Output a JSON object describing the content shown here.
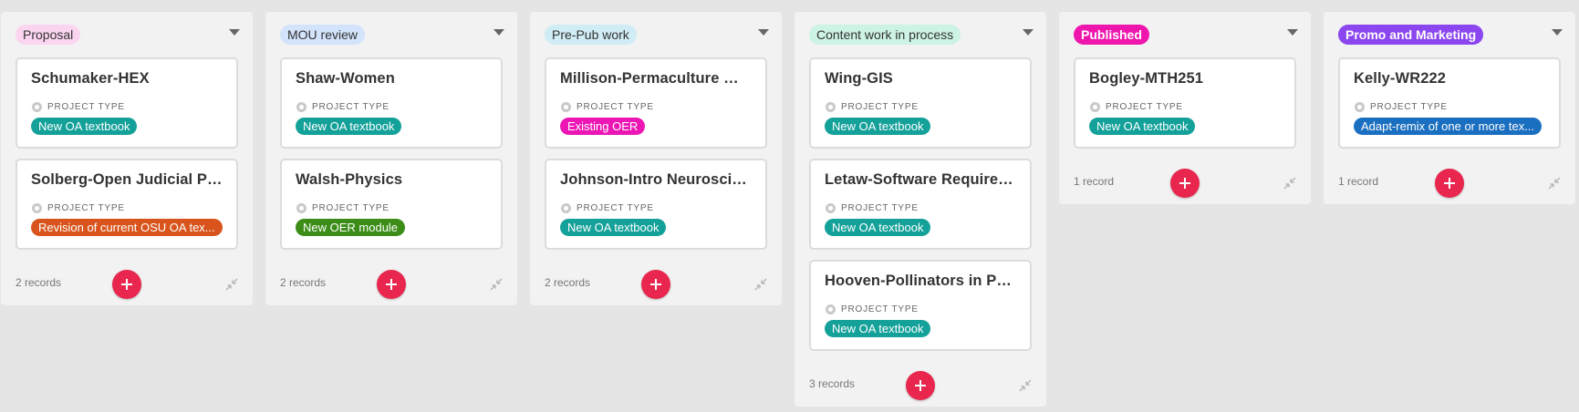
{
  "field_label": "PROJECT TYPE",
  "columns": [
    {
      "label": "Proposal",
      "label_bg": "#fbd5f0",
      "dark": false,
      "count": "2 records",
      "cards": [
        {
          "title": "Schumaker-HEX",
          "type": "New OA textbook",
          "type_color": "#13a199"
        },
        {
          "title": "Solberg-Open Judicial Poli...",
          "type": "Revision of current OSU OA tex...",
          "type_color": "#d9541c"
        }
      ]
    },
    {
      "label": "MOU review",
      "label_bg": "#d2e3fb",
      "dark": false,
      "count": "2 records",
      "cards": [
        {
          "title": "Shaw-Women",
          "type": "New OA textbook",
          "type_color": "#13a199"
        },
        {
          "title": "Walsh-Physics",
          "type": "New OER module",
          "type_color": "#3b8d17"
        }
      ]
    },
    {
      "label": "Pre-Pub work",
      "label_bg": "#d0ecf4",
      "dark": false,
      "count": "2 records",
      "cards": [
        {
          "title": "Millison-Permaculture We...",
          "type": "Existing OER",
          "type_color": "#ec16b5"
        },
        {
          "title": "Johnson-Intro Neuroscience",
          "type": "New OA textbook",
          "type_color": "#13a199"
        }
      ]
    },
    {
      "label": "Content work in process",
      "label_bg": "#cdf3e4",
      "dark": false,
      "count": "3 records",
      "cards": [
        {
          "title": "Wing-GIS",
          "type": "New OA textbook",
          "type_color": "#13a199"
        },
        {
          "title": "Letaw-Software Requirem...",
          "type": "New OA textbook",
          "type_color": "#13a199"
        },
        {
          "title": "Hooven-Pollinators in Peril",
          "type": "New OA textbook",
          "type_color": "#13a199"
        }
      ]
    },
    {
      "label": "Published",
      "label_bg": "#ef16ad",
      "dark": true,
      "count": "1 record",
      "cards": [
        {
          "title": "Bogley-MTH251",
          "type": "New OA textbook",
          "type_color": "#13a199"
        }
      ]
    },
    {
      "label": "Promo and Marketing",
      "label_bg": "#8b46ef",
      "dark": true,
      "count": "1 record",
      "cards": [
        {
          "title": "Kelly-WR222",
          "type": "Adapt-remix of one or more tex...",
          "type_color": "#1b6fc0"
        }
      ]
    }
  ]
}
